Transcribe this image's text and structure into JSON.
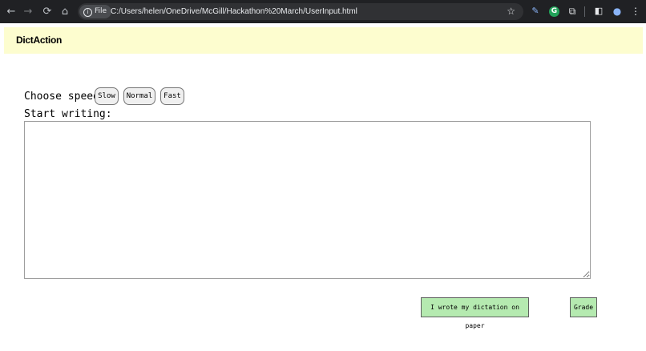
{
  "browser": {
    "file_chip": "File",
    "url": "C:/Users/helen/OneDrive/McGill/Hackathon%20March/UserInput.html",
    "nav": {
      "back": "←",
      "forward": "→",
      "reload": "⟳",
      "home": "⌂"
    },
    "icons": [
      "star-icon",
      "pen-icon",
      "grammarly-icon",
      "extensions-icon",
      "sidebar-icon",
      "profile-icon",
      "menu-icon"
    ]
  },
  "app": {
    "title": "DictAction",
    "header_color": "#fdfdcf"
  },
  "speed": {
    "label": "Choose speed:",
    "options": [
      "Slow",
      "Normal",
      "Fast"
    ]
  },
  "writing": {
    "label": "Start writing:",
    "value": "",
    "placeholder": ""
  },
  "actions": {
    "paper_label": "I wrote my dictation on paper",
    "grade_label": "Grade",
    "button_color": "#b5eab0"
  }
}
